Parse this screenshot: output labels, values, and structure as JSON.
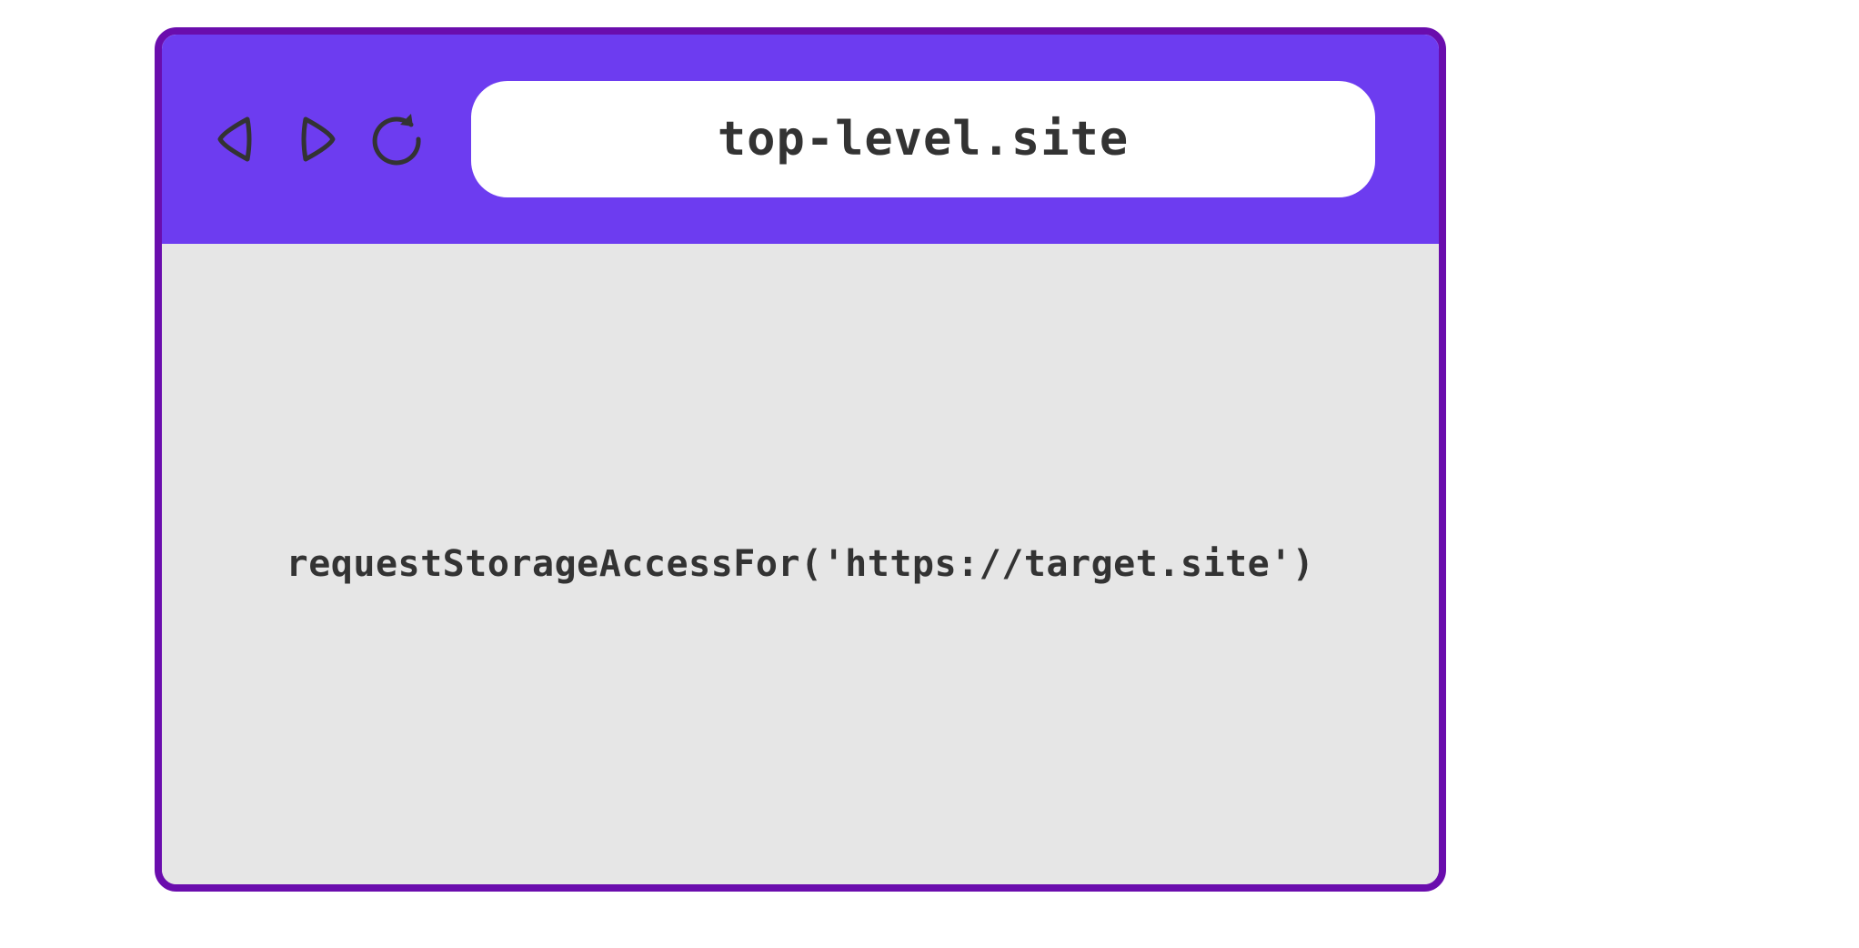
{
  "browser": {
    "url": "top-level.site"
  },
  "content": {
    "code": "requestStorageAccessFor('https://target.site')"
  }
}
